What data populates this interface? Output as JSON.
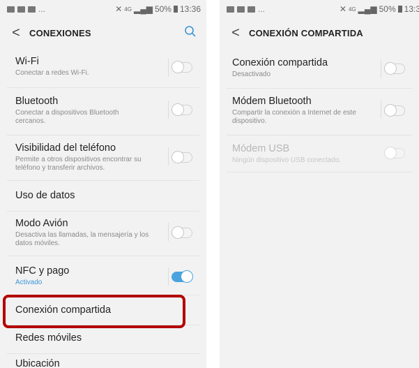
{
  "left": {
    "status": {
      "time": "13:36",
      "battery": "50%",
      "network": "4G"
    },
    "title": "CONEXIONES",
    "items": [
      {
        "title": "Wi-Fi",
        "subtitle": "Conectar a redes Wi-Fi.",
        "toggle": "off"
      },
      {
        "title": "Bluetooth",
        "subtitle": "Conectar a dispositivos Bluetooth cercanos.",
        "toggle": "off"
      },
      {
        "title": "Visibilidad del teléfono",
        "subtitle": "Permite a otros dispositivos encontrar su teléfono y transferir archivos.",
        "toggle": "off"
      },
      {
        "title": "Uso de datos"
      },
      {
        "title": "Modo Avión",
        "subtitle": "Desactiva las llamadas, la mensajería y los datos móviles.",
        "toggle": "off"
      },
      {
        "title": "NFC y pago",
        "subtitle": "Activado",
        "toggle": "on"
      },
      {
        "title": "Conexión compartida"
      },
      {
        "title": "Redes móviles"
      },
      {
        "title": "Ubicación"
      }
    ]
  },
  "right": {
    "status": {
      "time": "13:3",
      "battery": "50%",
      "network": "4G"
    },
    "title": "CONEXIÓN COMPARTIDA",
    "items": [
      {
        "title": "Conexión compartida",
        "subtitle": "Desactivado",
        "toggle": "off"
      },
      {
        "title": "Módem Bluetooth",
        "subtitle": "Compartir la conexión a Internet de este dispositivo.",
        "toggle": "off"
      },
      {
        "title": "Módem USB",
        "subtitle": "Ningún dispositivo USB conectado.",
        "toggle": "off",
        "disabled": true
      }
    ]
  },
  "colors": {
    "accent": "#3d96d6",
    "highlight": "#b20000",
    "background": "#f2f2f2"
  }
}
